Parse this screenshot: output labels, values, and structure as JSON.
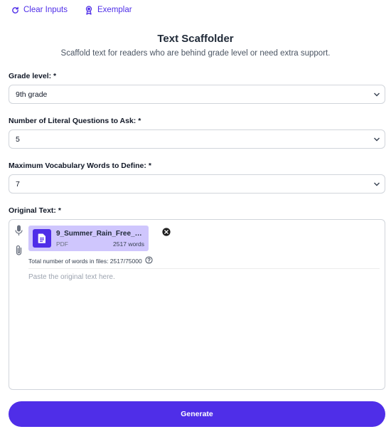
{
  "toolbar": {
    "clear_label": "Clear Inputs",
    "clear_icon": "refresh-icon",
    "exemplar_label": "Exemplar",
    "exemplar_icon": "badge-icon"
  },
  "header": {
    "title": "Text Scaffolder",
    "subtitle": "Scaffold text for readers who are behind grade level or need extra support."
  },
  "form": {
    "grade": {
      "label": "Grade level: *",
      "value": "9th grade"
    },
    "literal_questions": {
      "label": "Number of Literal Questions to Ask: *",
      "value": "5"
    },
    "vocab_words": {
      "label": "Maximum Vocabulary Words to Define: *",
      "value": "7"
    },
    "original_text": {
      "label": "Original Text: *",
      "placeholder": "Paste the original text here.",
      "value": "",
      "attachment": {
        "name": "9_Summer_Rain_Free_S...",
        "type": "PDF",
        "words": "2517 words"
      },
      "total_words_label": "Total number of words in files: 2517/75000"
    }
  },
  "actions": {
    "generate_label": "Generate"
  },
  "colors": {
    "accent": "#4f2ee8",
    "chip_bg": "#cfc6fd",
    "border": "#d1d5db",
    "placeholder": "#9ca3af"
  }
}
